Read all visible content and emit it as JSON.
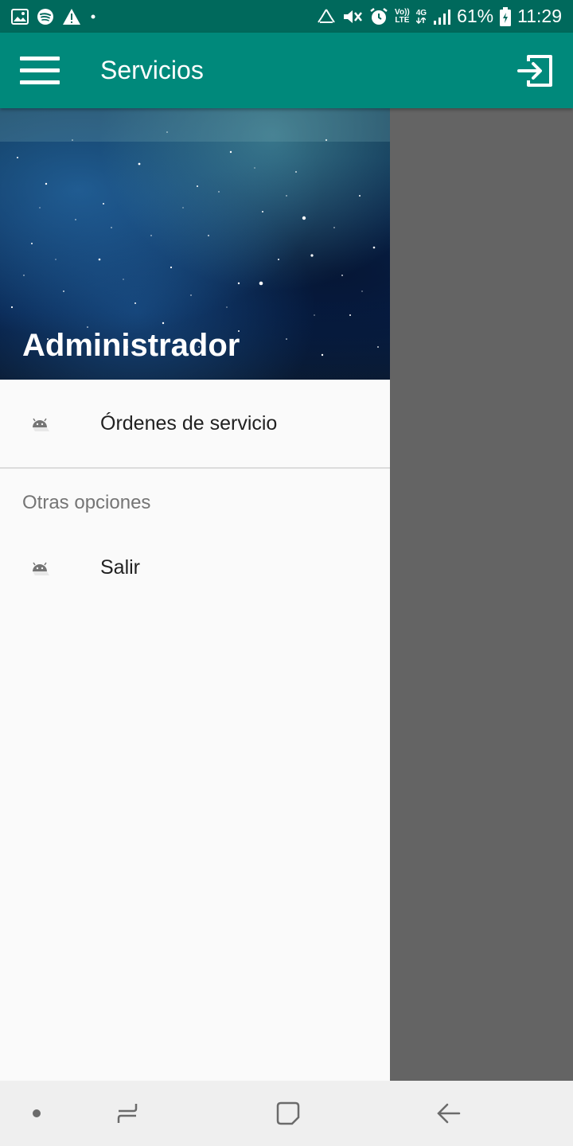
{
  "status_bar": {
    "battery_percent": "61%",
    "time": "11:29",
    "volte_top": "Vo))",
    "volte_bottom": "LTE",
    "network": "4G",
    "left_icons": [
      "image-icon",
      "spotify-icon",
      "warning-icon",
      "dot-icon"
    ],
    "right_icons": [
      "recycle-icon",
      "mute-icon",
      "alarm-icon",
      "volte-icon",
      "network-4g-icon",
      "signal-icon",
      "battery-icon"
    ]
  },
  "app_bar": {
    "title": "Servicios",
    "menu_icon": "hamburger-menu-icon",
    "action_icon": "exit-to-app-icon",
    "color": "#00897b",
    "status_color": "#00695c"
  },
  "drawer": {
    "header_title": "Administrador",
    "items": [
      {
        "label": "Órdenes de servicio",
        "icon": "android-icon"
      }
    ],
    "section_title": "Otras opciones",
    "other_items": [
      {
        "label": "Salir",
        "icon": "android-icon"
      }
    ]
  },
  "nav_bar": {
    "icons": [
      "dot-icon",
      "recents-icon",
      "home-icon",
      "back-icon"
    ]
  }
}
